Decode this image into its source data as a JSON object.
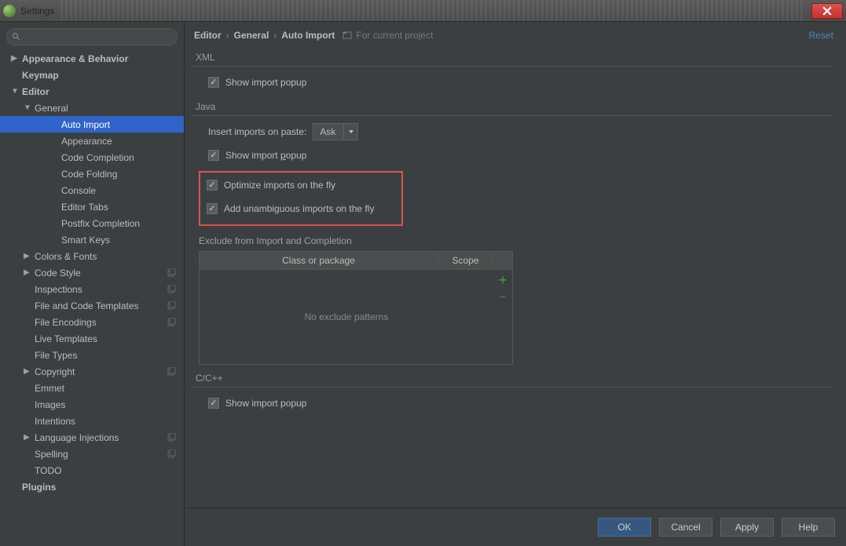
{
  "window": {
    "title": "Settings"
  },
  "search": {
    "placeholder": ""
  },
  "sidebar": {
    "items": [
      {
        "label": "Appearance & Behavior",
        "level": 1,
        "caret": "right",
        "bold": true
      },
      {
        "label": "Keymap",
        "level": 1,
        "caret": "none",
        "bold": true
      },
      {
        "label": "Editor",
        "level": 1,
        "caret": "down",
        "bold": true
      },
      {
        "label": "General",
        "level": 2,
        "caret": "down"
      },
      {
        "label": "Auto Import",
        "level": 3,
        "caret": "none",
        "selected": true
      },
      {
        "label": "Appearance",
        "level": 3,
        "caret": "none"
      },
      {
        "label": "Code Completion",
        "level": 3,
        "caret": "none"
      },
      {
        "label": "Code Folding",
        "level": 3,
        "caret": "none"
      },
      {
        "label": "Console",
        "level": 3,
        "caret": "none"
      },
      {
        "label": "Editor Tabs",
        "level": 3,
        "caret": "none"
      },
      {
        "label": "Postfix Completion",
        "level": 3,
        "caret": "none"
      },
      {
        "label": "Smart Keys",
        "level": 3,
        "caret": "none"
      },
      {
        "label": "Colors & Fonts",
        "level": 2,
        "caret": "right"
      },
      {
        "label": "Code Style",
        "level": 2,
        "caret": "right",
        "copy": true
      },
      {
        "label": "Inspections",
        "level": 2,
        "caret": "none",
        "copy": true
      },
      {
        "label": "File and Code Templates",
        "level": 2,
        "caret": "none",
        "copy": true
      },
      {
        "label": "File Encodings",
        "level": 2,
        "caret": "none",
        "copy": true
      },
      {
        "label": "Live Templates",
        "level": 2,
        "caret": "none"
      },
      {
        "label": "File Types",
        "level": 2,
        "caret": "none"
      },
      {
        "label": "Copyright",
        "level": 2,
        "caret": "right",
        "copy": true
      },
      {
        "label": "Emmet",
        "level": 2,
        "caret": "none"
      },
      {
        "label": "Images",
        "level": 2,
        "caret": "none"
      },
      {
        "label": "Intentions",
        "level": 2,
        "caret": "none"
      },
      {
        "label": "Language Injections",
        "level": 2,
        "caret": "right",
        "copy": true
      },
      {
        "label": "Spelling",
        "level": 2,
        "caret": "none",
        "copy": true
      },
      {
        "label": "TODO",
        "level": 2,
        "caret": "none"
      },
      {
        "label": "Plugins",
        "level": 1,
        "caret": "none",
        "bold": true
      }
    ]
  },
  "breadcrumb": {
    "parts": [
      "Editor",
      "General",
      "Auto Import"
    ],
    "note": "For current project",
    "reset": "Reset"
  },
  "sections": {
    "xml": {
      "title": "XML",
      "show_popup": {
        "label": "Show import popup",
        "checked": true
      }
    },
    "java": {
      "title": "Java",
      "insert_label": "Insert imports on paste:",
      "insert_value": "Ask",
      "show_popup_label_pre": "Show import ",
      "show_popup_label_u": "p",
      "show_popup_label_post": "opup",
      "show_popup_checked": true,
      "optimize": {
        "label": "Optimize imports on the fly",
        "checked": true
      },
      "unambiguous": {
        "label": "Add unambiguous imports on the fly",
        "checked": true
      },
      "exclude_title": "Exclude from Import and Completion",
      "table": {
        "col1": "Class or package",
        "col2": "Scope",
        "empty": "No exclude patterns"
      }
    },
    "cpp": {
      "title": "C/C++",
      "show_popup": {
        "label": "Show import popup",
        "checked": true
      }
    }
  },
  "footer": {
    "ok": "OK",
    "cancel": "Cancel",
    "apply": "Apply",
    "help": "Help"
  }
}
